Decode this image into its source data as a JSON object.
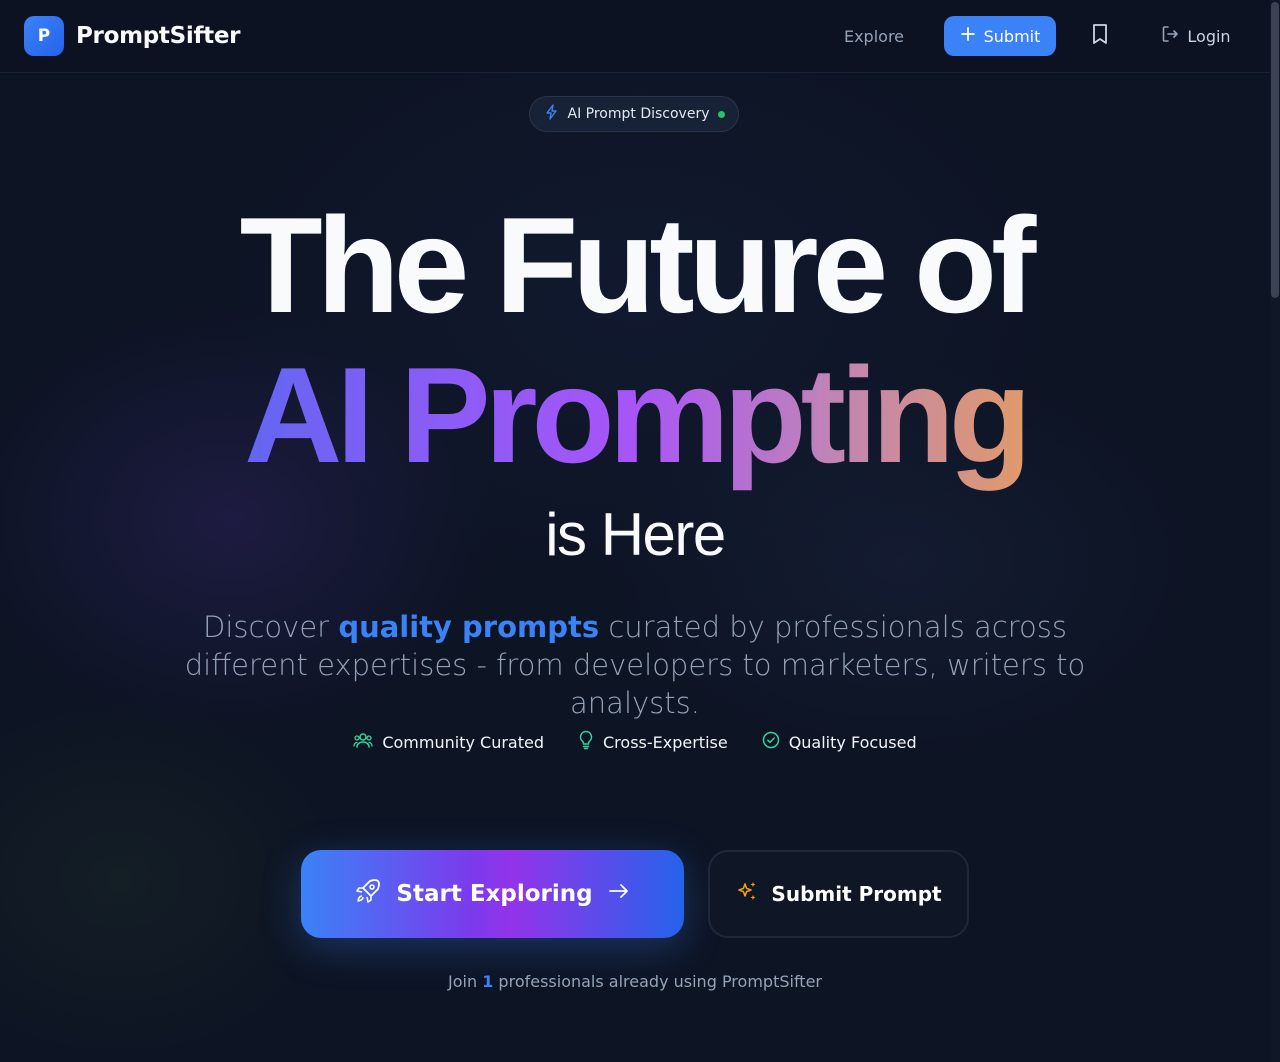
{
  "brand": {
    "logo_letter": "P",
    "name": "PromptSifter"
  },
  "nav": {
    "explore_label": "Explore",
    "submit_label": "Submit",
    "login_label": "Login"
  },
  "hero": {
    "badge_label": "AI Prompt Discovery",
    "headline_line1": "The Future of",
    "headline_line2": "AI Prompting",
    "headline_line3": "is Here",
    "lead_prefix": "Discover ",
    "lead_highlight": "quality prompts",
    "lead_suffix": " curated by professionals across different expertises - from developers to marketers, writers to analysts.",
    "features": [
      {
        "label": "Community Curated",
        "icon": "users-icon"
      },
      {
        "label": "Cross-Expertise",
        "icon": "lightbulb-icon"
      },
      {
        "label": "Quality Focused",
        "icon": "check-circle-icon"
      }
    ],
    "primary_cta": "Start Exploring",
    "secondary_cta": "Submit Prompt",
    "join_prefix": "Join ",
    "join_count": "1",
    "join_suffix": " professionals already using PromptSifter"
  },
  "colors": {
    "background": "#0d1424",
    "accent": "#3b82f6",
    "status_dot": "#22c55e",
    "feature_icon": "#34d399",
    "sparkle": "#f59e0b"
  }
}
